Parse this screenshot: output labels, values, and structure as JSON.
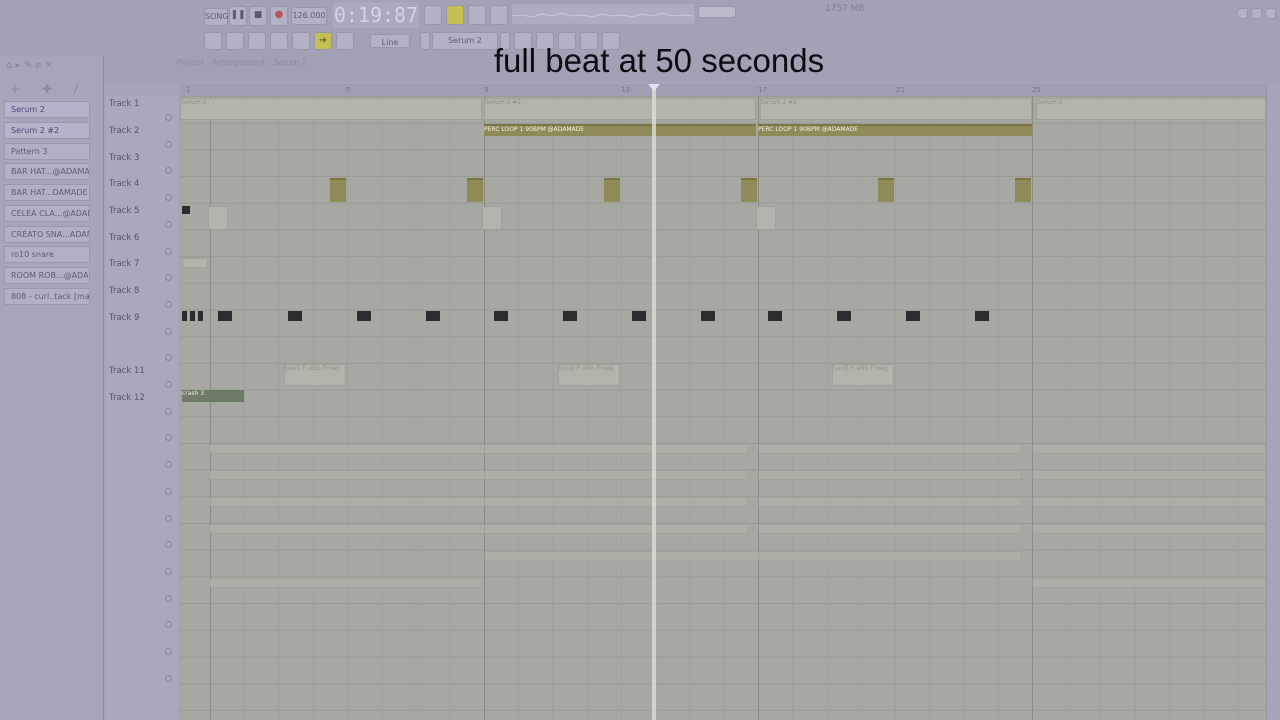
{
  "caption": "full beat at 50 seconds",
  "toolbar": {
    "song_label": "SONG",
    "tempo": "126.000",
    "time": "0:19:87",
    "pattern": "Serum 2",
    "line_mode": "Line",
    "memory": "1757 MB"
  },
  "browser": {
    "channels": [
      "Serum 2",
      "Serum 2 #2",
      "Pattern 3",
      "BAR HAT...@ADAMADE",
      "BAR HAT...DAMADE #2",
      "CELEA CLA...@ADAMADE",
      "CREATO SNA...ADAMADE",
      "ro10 snare",
      "ROOM ROB...@ADAMADE",
      "808 - curl..tack [mayze]"
    ]
  },
  "playlist": {
    "title": "Playlist - Arrangement - Serum 2",
    "tracks": [
      "Track 1",
      "Track 2",
      "Track 3",
      "Track 4",
      "Track 5",
      "Track 6",
      "Track 7",
      "Track 8",
      "Track 9",
      "",
      "Track 11",
      "Track 12"
    ],
    "ruler": [
      "1",
      "5",
      "9",
      "13",
      "17",
      "21",
      "25"
    ],
    "clips": {
      "serum": "Serum 2",
      "serum2": "Serum 2 #2",
      "perc": "PERC LOOP 1 90BPM @ADAMADE",
      "crash": "crash 3",
      "vox": "[snd] F..etto f'mag"
    }
  },
  "colors": {
    "accent": "#c4bf52",
    "clip_olive": "#8f8b58",
    "playhead": "#e3e2ea"
  }
}
